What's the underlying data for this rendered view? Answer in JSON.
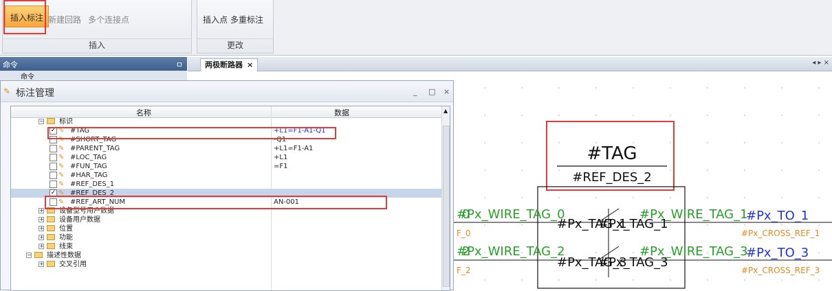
{
  "ribbon": {
    "insert_group": {
      "buttons": [
        "插入标注",
        "新建回路",
        "多个连接点"
      ],
      "label": "插入"
    },
    "change_group": {
      "buttons": [
        "插入点",
        "多重标注"
      ],
      "label": "更改"
    }
  },
  "command_panel": {
    "title": "命令",
    "pin": "ㅁ",
    "tab_label": "命令"
  },
  "doc_tab": {
    "title": "两极断路器",
    "close": "×",
    "nav": "◂ ▸ ×"
  },
  "dialog": {
    "title": "标注管理",
    "controls": {
      "minimize": "_",
      "maximize": "□",
      "close": "×"
    },
    "columns": {
      "name": "名称",
      "data": "数据"
    },
    "rows": [
      {
        "label": "标识",
        "kind": "folder",
        "expanded": true,
        "value": ""
      },
      {
        "label": "#TAG",
        "kind": "item",
        "checked": true,
        "value": "+L1=F1-A1-Q1",
        "highlight_value": true
      },
      {
        "label": "#SHORT_TAG",
        "kind": "item",
        "checked": false,
        "value": "-Q1"
      },
      {
        "label": "#PARENT_TAG",
        "kind": "item",
        "checked": false,
        "value": "+L1=F1-A1"
      },
      {
        "label": "#LOC_TAG",
        "kind": "item",
        "checked": false,
        "value": "+L1"
      },
      {
        "label": "#FUN_TAG",
        "kind": "item",
        "checked": false,
        "value": "=F1"
      },
      {
        "label": "#HAR_TAG",
        "kind": "item",
        "checked": false,
        "value": ""
      },
      {
        "label": "#REF_DES_1",
        "kind": "item",
        "checked": false,
        "value": ""
      },
      {
        "label": "#REF_DES_2",
        "kind": "item",
        "checked": true,
        "value": "",
        "selected": true
      },
      {
        "label": "#REF_ART_NUM",
        "kind": "item",
        "checked": false,
        "value": "AN-001"
      },
      {
        "label": "设备型号用户数据",
        "kind": "folder",
        "expanded": false,
        "value": ""
      },
      {
        "label": "设备用户数据",
        "kind": "folder",
        "expanded": false,
        "value": ""
      },
      {
        "label": "位置",
        "kind": "folder",
        "expanded": false,
        "value": ""
      },
      {
        "label": "功能",
        "kind": "folder",
        "expanded": false,
        "value": ""
      },
      {
        "label": "线束",
        "kind": "folder",
        "expanded": false,
        "value": ""
      },
      {
        "label": "描述性数据",
        "kind": "folder",
        "expanded": true,
        "value": "",
        "root": true
      },
      {
        "label": "交叉引用",
        "kind": "folder",
        "expanded": false,
        "value": ""
      }
    ]
  },
  "canvas": {
    "tag_label": "#TAG",
    "ref_label": "#REF_DES_2",
    "wire_tag_0": "#Px_WIRE_TAG_0",
    "wire_tag_1": "#Px_WIRE_TAG_1",
    "wire_tag_2": "#Px_WIRE_TAG_2",
    "wire_tag_3": "#Px_WIRE_TAG_3",
    "px_tag_1": "#Px_TAG_1",
    "px_tag_3": "#Px_TAG_3",
    "inner_tag_1": "#Px_TAG_1",
    "inner_tag_3": "#Px_TAG_3",
    "to_1": "#Px_TO_1",
    "to_3": "#Px_TO_3",
    "cross_ref_1": "#Px_CROSS_REF_1",
    "cross_ref_3": "#Px_CROSS_REF_3",
    "f0": "F_0",
    "f2": "F_2",
    "num0": "0",
    "num2": "2",
    "colors": {
      "green": "#2aa02a",
      "orange": "#e58a1f",
      "blue": "#2233dd"
    }
  }
}
